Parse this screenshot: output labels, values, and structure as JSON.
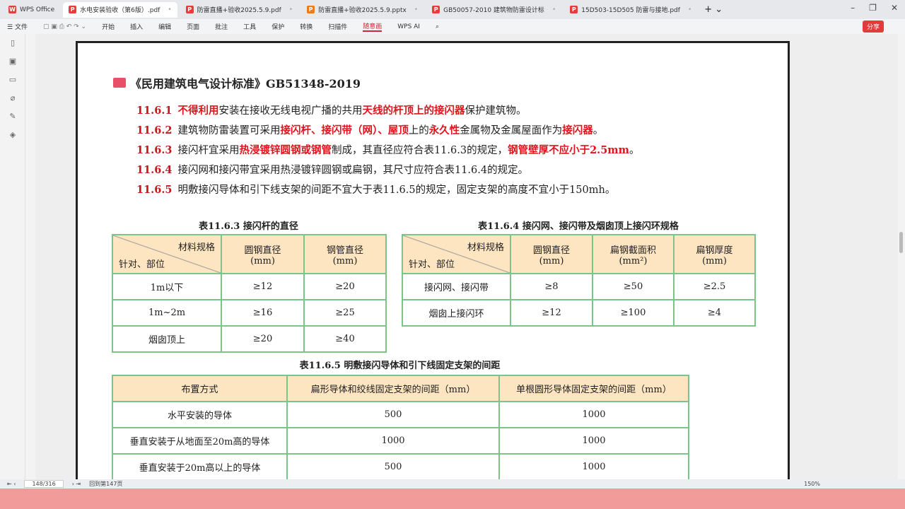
{
  "tabs": [
    {
      "label": "WPS Office",
      "type": "wps"
    },
    {
      "label": "水电安装验收（第6版）.pdf",
      "type": "pdf",
      "active": true
    },
    {
      "label": "防雷直播+验收2025.5.9.pdf",
      "type": "pdf"
    },
    {
      "label": "防雷直播+验收2025.5.9.pptx",
      "type": "ppt"
    },
    {
      "label": "GB50057-2010 建筑物防雷设计标",
      "type": "pdf"
    },
    {
      "label": "15D503-15D505 防雷与接地.pdf",
      "type": "pdf"
    }
  ],
  "menu": {
    "file": "文件",
    "items": [
      "开始",
      "插入",
      "编辑",
      "页面",
      "批注",
      "工具",
      "保护",
      "转换",
      "扫描件",
      "随意画",
      "WPS AI"
    ],
    "selected": "随意画",
    "share": "分享"
  },
  "doc": {
    "heading": "《民用建筑电气设计标准》GB51348-2019",
    "clauses": [
      {
        "num": "11.6.1",
        "parts": [
          [
            "不得利用",
            1
          ],
          [
            "安装在接收无线电视广播的共用",
            0
          ],
          [
            "天线的杆顶上的接闪器",
            1
          ],
          [
            "保护建筑物。",
            0
          ]
        ]
      },
      {
        "num": "11.6.2",
        "parts": [
          [
            "建筑物防雷装置可采用",
            0
          ],
          [
            "接闪杆、接闪带（网）、屋顶",
            1
          ],
          [
            "上的",
            0
          ],
          [
            "永久性",
            1
          ],
          [
            "金属物及金属屋面作为",
            0
          ],
          [
            "接闪器",
            1
          ],
          [
            "。",
            0
          ]
        ]
      },
      {
        "num": "11.6.3",
        "parts": [
          [
            "接闪杆宜采用",
            0
          ],
          [
            "热浸镀锌圆钢或钢管",
            1
          ],
          [
            "制成，其直径应符合表11.6.3的规定，",
            0
          ],
          [
            "钢管壁厚不应小于2.5mm",
            1
          ],
          [
            "。",
            0
          ]
        ]
      },
      {
        "num": "11.6.4",
        "parts": [
          [
            "接闪网和接闪带宜采用热浸镀锌圆钢或扁钢，其尺寸应符合表11.6.4的规定。",
            0
          ]
        ]
      },
      {
        "num": "11.6.5",
        "parts": [
          [
            "明敷接闪导体和引下线支架的间距不宜大于表11.6.5的规定，固定支架的高度不宜小于150mh。",
            0
          ]
        ]
      }
    ],
    "t1": {
      "caption": "表11.6.3 接闪杆的直径",
      "diag_top": "材料规格",
      "diag_bottom": "针对、部位",
      "cols": [
        "圆钢直径\n(mm)",
        "钢管直径\n(mm)"
      ],
      "rows": [
        [
          "1m以下",
          "≥12",
          "≥20"
        ],
        [
          "1m~2m",
          "≥16",
          "≥25"
        ],
        [
          "烟囱顶上",
          "≥20",
          "≥40"
        ]
      ]
    },
    "t2": {
      "caption": "表11.6.4 接闪网、接闪带及烟囱顶上接闪环规格",
      "diag_top": "材料规格",
      "diag_bottom": "针对、部位",
      "cols": [
        "圆钢直径\n(mm)",
        "扁钢截面积\n(mm²)",
        "扁钢厚度\n(mm)"
      ],
      "rows": [
        [
          "接闪网、接闪带",
          "≥8",
          "≥50",
          "≥2.5"
        ],
        [
          "烟囱上接闪环",
          "≥12",
          "≥100",
          "≥4"
        ]
      ]
    },
    "t3": {
      "caption": "表11.6.5 明敷接闪导体和引下线固定支架的间距",
      "cols": [
        "布置方式",
        "扁形导体和绞线固定支架的间距（mm）",
        "单根圆形导体固定支架的间距（mm）"
      ],
      "rows": [
        [
          "水平安装的导体",
          "500",
          "1000"
        ],
        [
          "垂直安装于从地面至20m高的导体",
          "1000",
          "1000"
        ],
        [
          "垂直安装于20m高以上的导体",
          "500",
          "1000"
        ]
      ]
    }
  },
  "status": {
    "page": "148/316",
    "back": "回到第147页",
    "zoom": "150%"
  }
}
